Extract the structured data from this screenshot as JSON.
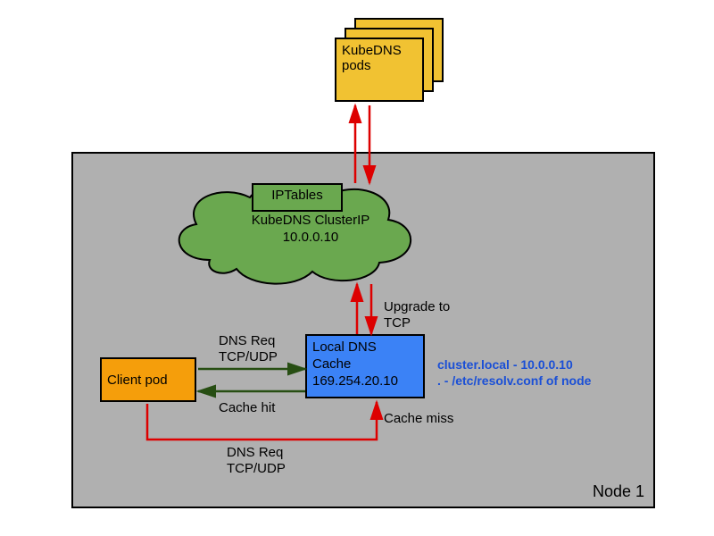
{
  "kubedns": {
    "label": "KubeDNS pods"
  },
  "node": {
    "label": "Node 1"
  },
  "cloud": {
    "iptables": "IPTables",
    "line1": "KubeDNS ClusterIP",
    "line2": "10.0.0.10"
  },
  "client_pod": {
    "label": "Client pod"
  },
  "dns_cache": {
    "line1": "Local DNS",
    "line2": "Cache",
    "line3": "169.254.20.10"
  },
  "annotation": {
    "line1": "cluster.local - 10.0.0.10",
    "line2": ". - /etc/resolv.conf of node"
  },
  "labels": {
    "dns_req_top": "DNS Req",
    "tcp_udp_top": "TCP/UDP",
    "cache_hit": "Cache hit",
    "dns_req_bottom": "DNS Req",
    "tcp_udp_bottom": "TCP/UDP",
    "cache_miss": "Cache miss",
    "upgrade1": "Upgrade to",
    "upgrade2": "TCP"
  }
}
